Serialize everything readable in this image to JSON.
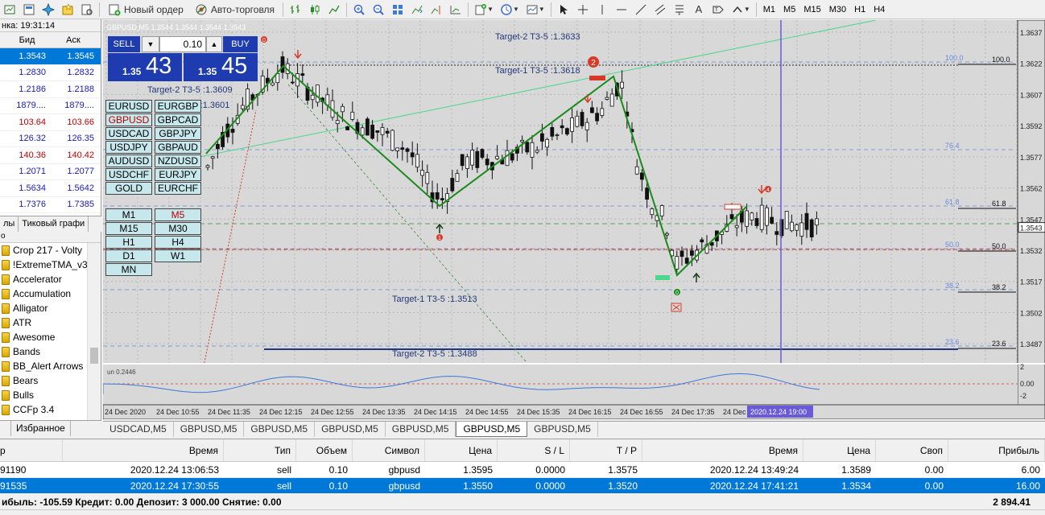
{
  "toolbar": {
    "new_order": "Новый ордер",
    "autotrading": "Авто-торговля",
    "timeframes": [
      "M1",
      "M5",
      "M15",
      "M30",
      "H1",
      "H4"
    ]
  },
  "market_watch": {
    "time_label": "нка: 19:31:14",
    "col_bid": "Бид",
    "col_ask": "Аск",
    "rows": [
      {
        "bid": "1.3543",
        "ask": "1.3545",
        "color": "sel"
      },
      {
        "bid": "1.2830",
        "ask": "1.2832",
        "color": "blue"
      },
      {
        "bid": "1.2186",
        "ask": "1.2188",
        "color": "blue"
      },
      {
        "bid": "1879....",
        "ask": "1879....",
        "color": "blue"
      },
      {
        "bid": "103.64",
        "ask": "103.66",
        "color": "red"
      },
      {
        "bid": "126.32",
        "ask": "126.35",
        "color": "blue"
      },
      {
        "bid": "140.36",
        "ask": "140.42",
        "color": "red"
      },
      {
        "bid": "1.2071",
        "ask": "1.2077",
        "color": "blue"
      },
      {
        "bid": "1.5634",
        "ask": "1.5642",
        "color": "blue"
      },
      {
        "bid": "1.7376",
        "ask": "1.7385",
        "color": "blue"
      }
    ],
    "tabs": [
      "лы",
      "Тиковый графи"
    ]
  },
  "navigator": {
    "header": "о",
    "items": [
      "Crop 217 - Volty",
      "!ExtremeTMA_v3",
      "Accelerator",
      "Accumulation",
      "Alligator",
      "ATR",
      "Awesome",
      "Bands",
      "BB_Alert Arrows",
      "Bears",
      "Bulls",
      "CCFp 3.4"
    ],
    "tabs": [
      "",
      "Избранное"
    ]
  },
  "chart": {
    "title": "GBPUSD,M5  1.3544 1.3544 1.3544 1.3543",
    "indicator_label": "un 0.2446",
    "price_labels": [
      "1.3637",
      "1.3622",
      "1.3607",
      "1.3592",
      "1.3577",
      "1.3562",
      "1.3547",
      "1.3543",
      "1.3532",
      "1.3517",
      "1.3502",
      "1.3487"
    ],
    "time_labels": [
      "24 Dec 2020",
      "24 Dec 10:55",
      "24 Dec 11:35",
      "24 Dec 12:15",
      "24 Dec 12:55",
      "24 Dec 13:35",
      "24 Dec 14:15",
      "24 Dec 14:55",
      "24 Dec 15:35",
      "24 Dec 16:15",
      "24 Dec 16:55",
      "24 Dec 17:35",
      "24 Dec",
      "2020.12.24 19:00"
    ],
    "indicator_axis": [
      "2",
      "0.00",
      "-2"
    ],
    "fib_levels": [
      {
        "label": "100.0",
        "right": "100.0"
      },
      {
        "label": "76.4",
        "right": ""
      },
      {
        "label": "61.8",
        "right": "61.8"
      },
      {
        "label": "50.0",
        "right": "50.0"
      },
      {
        "label": "38.2",
        "right": "38.2"
      },
      {
        "label": "23.6",
        "right": "23.6"
      }
    ],
    "targets": {
      "t2_top": "Target-2 T3-5 :1.3633",
      "t1_top": "Target-1 T3-5 :1.3618",
      "t2_left": "Target-2 T3-5 :1.3609",
      "t1_left": "T3-5 :1.3601",
      "t1_bottom": "Target-1 T3-5 :1.3513",
      "t2_bottom": "Target-2 T3-5 :1.3488"
    },
    "wave_labels": [
      "0",
      "2",
      "1",
      "4",
      "0"
    ]
  },
  "oneclick": {
    "sell": "SELL",
    "buy": "BUY",
    "lot": "0.10",
    "sell_small": "1.35",
    "sell_big": "43",
    "buy_small": "1.35",
    "buy_big": "45"
  },
  "symbols": {
    "pairs": [
      "EURUSD",
      "EURGBP",
      "GBPUSD",
      "GBPCAD",
      "USDCAD",
      "GBPJPY",
      "USDJPY",
      "GBPAUD",
      "AUDUSD",
      "NZDUSD",
      "USDCHF",
      "EURJPY",
      "GOLD",
      "EURCHF"
    ],
    "timeframes": [
      "M1",
      "M5",
      "M15",
      "M30",
      "H1",
      "H4",
      "D1",
      "W1",
      "MN"
    ]
  },
  "chart_tabs": [
    "USDCAD,M5",
    "GBPUSD,M5",
    "GBPUSD,M5",
    "GBPUSD,M5",
    "GBPUSD,M5",
    "GBPUSD,M5",
    "GBPUSD,M5"
  ],
  "terminal": {
    "headers": [
      "р",
      "Время",
      "Тип",
      "Объем",
      "Символ",
      "Цена",
      "S / L",
      "T / P",
      "Время",
      "Цена",
      "Своп",
      "Прибыль"
    ],
    "rows": [
      [
        "91190",
        "2020.12.24 13:06:53",
        "sell",
        "0.10",
        "gbpusd",
        "1.3595",
        "0.0000",
        "1.3575",
        "2020.12.24 13:49:24",
        "1.3589",
        "0.00",
        "6.00"
      ],
      [
        "91535",
        "2020.12.24 17:30:55",
        "sell",
        "0.10",
        "gbpusd",
        "1.3550",
        "0.0000",
        "1.3520",
        "2020.12.24 17:41:21",
        "1.3534",
        "0.00",
        "16.00"
      ]
    ],
    "summary": "ибыль: -105.59  Кредит: 0.00  Депозит: 3 000.00  Снятие: 0.00",
    "total": "2 894.41"
  }
}
